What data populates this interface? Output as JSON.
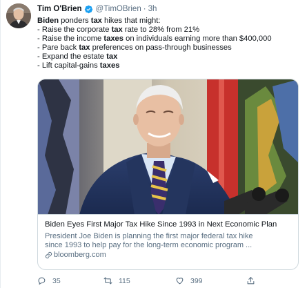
{
  "tweet": {
    "author_name": "Tim O'Brien",
    "handle": "@TimOBrien",
    "separator": "·",
    "time": "3h",
    "lines": [
      [
        {
          "t": "Biden",
          "b": true
        },
        {
          "t": " ponders ",
          "b": false
        },
        {
          "t": "tax",
          "b": true
        },
        {
          "t": " hikes that might:",
          "b": false
        }
      ],
      [
        {
          "t": "- Raise the corporate ",
          "b": false
        },
        {
          "t": "tax",
          "b": true
        },
        {
          "t": " rate to 28% from 21%",
          "b": false
        }
      ],
      [
        {
          "t": "- Raise the income ",
          "b": false
        },
        {
          "t": "taxes",
          "b": true
        },
        {
          "t": " on individuals earning more than $400,000",
          "b": false
        }
      ],
      [
        {
          "t": "- Pare back ",
          "b": false
        },
        {
          "t": "tax",
          "b": true
        },
        {
          "t": " preferences on pass-through businesses",
          "b": false
        }
      ],
      [
        {
          "t": "- Expand the estate ",
          "b": false
        },
        {
          "t": "tax",
          "b": true
        }
      ],
      [
        {
          "t": "- Lift capital-gains ",
          "b": false
        },
        {
          "t": "taxes",
          "b": true
        }
      ]
    ]
  },
  "card": {
    "title": "Biden Eyes First Major Tax Hike Since 1993 in Next Economic Plan",
    "description_lines": [
      "President Joe Biden is planning the first major federal tax hike",
      "since 1993 to help pay for the long-term economic program ..."
    ],
    "domain": "bloomberg.com"
  },
  "actions": {
    "replies": "35",
    "retweets": "115",
    "likes": "399"
  },
  "icons": {
    "verified": "verified-badge-icon",
    "link": "link-icon",
    "reply": "reply-icon",
    "retweet": "retweet-icon",
    "like": "heart-icon",
    "share": "share-icon"
  },
  "colors": {
    "text": "#0f1419",
    "secondary": "#5b7083",
    "verified": "#1da1f2",
    "border": "#cfd9de"
  }
}
